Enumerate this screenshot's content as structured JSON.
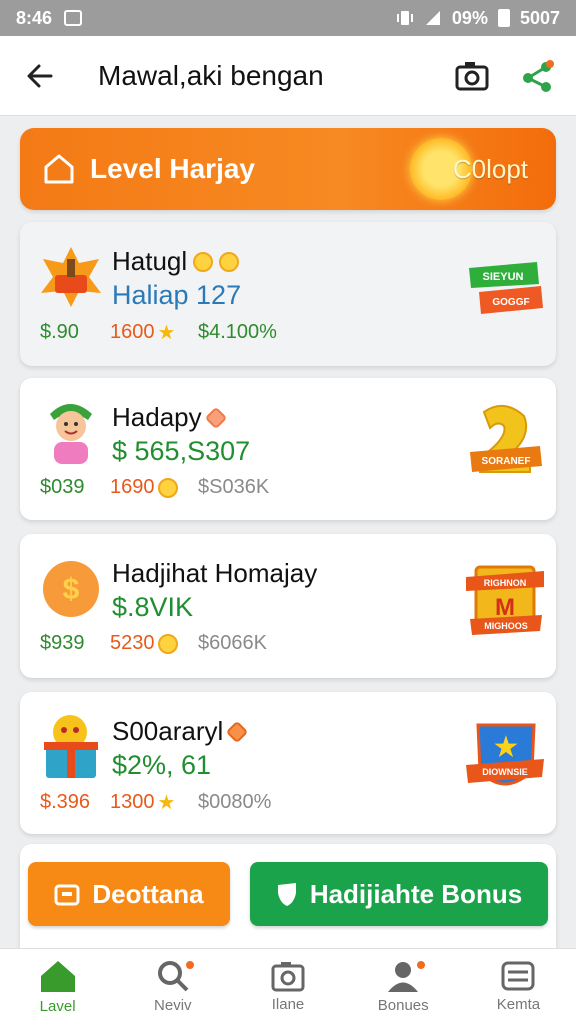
{
  "status_bar": {
    "time": "8:46",
    "battery": "09%",
    "signal": "5007"
  },
  "app_bar": {
    "title": "Mawal,aki bengan"
  },
  "banner": {
    "title": "Level Harjay",
    "badge": "C0lopt"
  },
  "cards": [
    {
      "name": "Hatugl",
      "amount": "Haliap 127",
      "stat1": "$.90",
      "stat2": "1600",
      "stat3": "$4.100%",
      "badge_top": "SIEYUN",
      "badge_bottom": "GOGGF"
    },
    {
      "name": "Hadapy",
      "amount": "$ 565,S307",
      "stat1": "$039",
      "stat2": "1690",
      "stat3": "$S036K",
      "badge": "SORANEF"
    },
    {
      "name": "Hadjihat Homajay",
      "amount": "$.8VIK",
      "stat1": "$939",
      "stat2": "5230",
      "stat3": "$6066K",
      "badge_top": "RIGHNON",
      "badge_letter": "M",
      "badge_bottom": "MIGHOOS"
    },
    {
      "name": "S00araryl",
      "amount": "$2%, 61",
      "stat1": "$.396",
      "stat2": "1300",
      "stat3": "$0080%",
      "badge": "DIOWNSIE"
    }
  ],
  "actions": {
    "left_label": "Deottana",
    "right_label": "Hadijiahte Bonus"
  },
  "nav": [
    {
      "label": "Lavel"
    },
    {
      "label": "Neviv"
    },
    {
      "label": "Ilane"
    },
    {
      "label": "Bonues"
    },
    {
      "label": "Kemta"
    }
  ],
  "colors": {
    "accent_orange": "#f78a14",
    "accent_green": "#1aa34a",
    "amount_green": "#1f8f2f",
    "amount_blue": "#2a7ab8",
    "stat_orange": "#e8591a"
  }
}
